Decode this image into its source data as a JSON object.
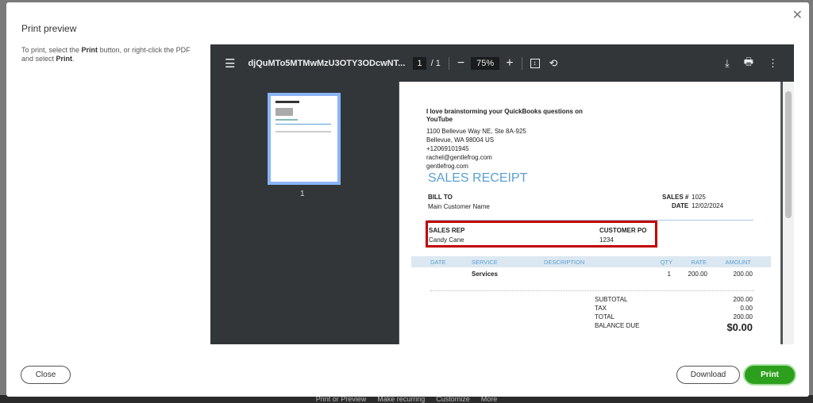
{
  "background_bar": [
    "Print or Preview",
    "Make recurring",
    "Customize",
    "More"
  ],
  "dialog": {
    "title": "Print preview",
    "instr_1": "To print, select the ",
    "instr_print": "Print",
    "instr_2": " button, or right-click the PDF and select ",
    "instr_print2": "Print",
    "instr_3": ".",
    "close_label": "Close",
    "download_label": "Download",
    "print_label": "Print",
    "print_color": "#2ca01c"
  },
  "viewer": {
    "filename": "djQuMTo5MTMwMzU3OTY3ODcwNT...",
    "page": "1",
    "page_total": "/ 1",
    "zoom": "75%",
    "thumb_label": "1"
  },
  "receipt": {
    "company": "I love brainstorming your QuickBooks questions on YouTube",
    "address1": "1100 Bellevue Way NE, Ste 8A-925",
    "address2": "Bellevue, WA  98004 US",
    "phone": "+12069101945",
    "email": "rachel@gentlefrog.com",
    "web": "gentlefrog.com",
    "title": "SALES RECEIPT",
    "bill_to_label": "BILL TO",
    "bill_to": "Main Customer Name",
    "sales_no_label": "SALES #",
    "sales_no": "1025",
    "date_label": "DATE",
    "date": "12/02/2024",
    "sales_rep_label": "SALES REP",
    "sales_rep": "Candy Cane",
    "po_label": "CUSTOMER PO",
    "po": "1234",
    "columns": [
      "DATE",
      "SERVICE",
      "DESCRIPTION",
      "QTY",
      "RATE",
      "AMOUNT"
    ],
    "line": {
      "service": "Services",
      "qty": "1",
      "rate": "200.00",
      "amount": "200.00"
    },
    "subtotal_label": "SUBTOTAL",
    "subtotal": "200.00",
    "tax_label": "TAX",
    "tax": "0.00",
    "total_label": "TOTAL",
    "total": "200.00",
    "balance_label": "BALANCE DUE",
    "balance": "$0.00"
  }
}
